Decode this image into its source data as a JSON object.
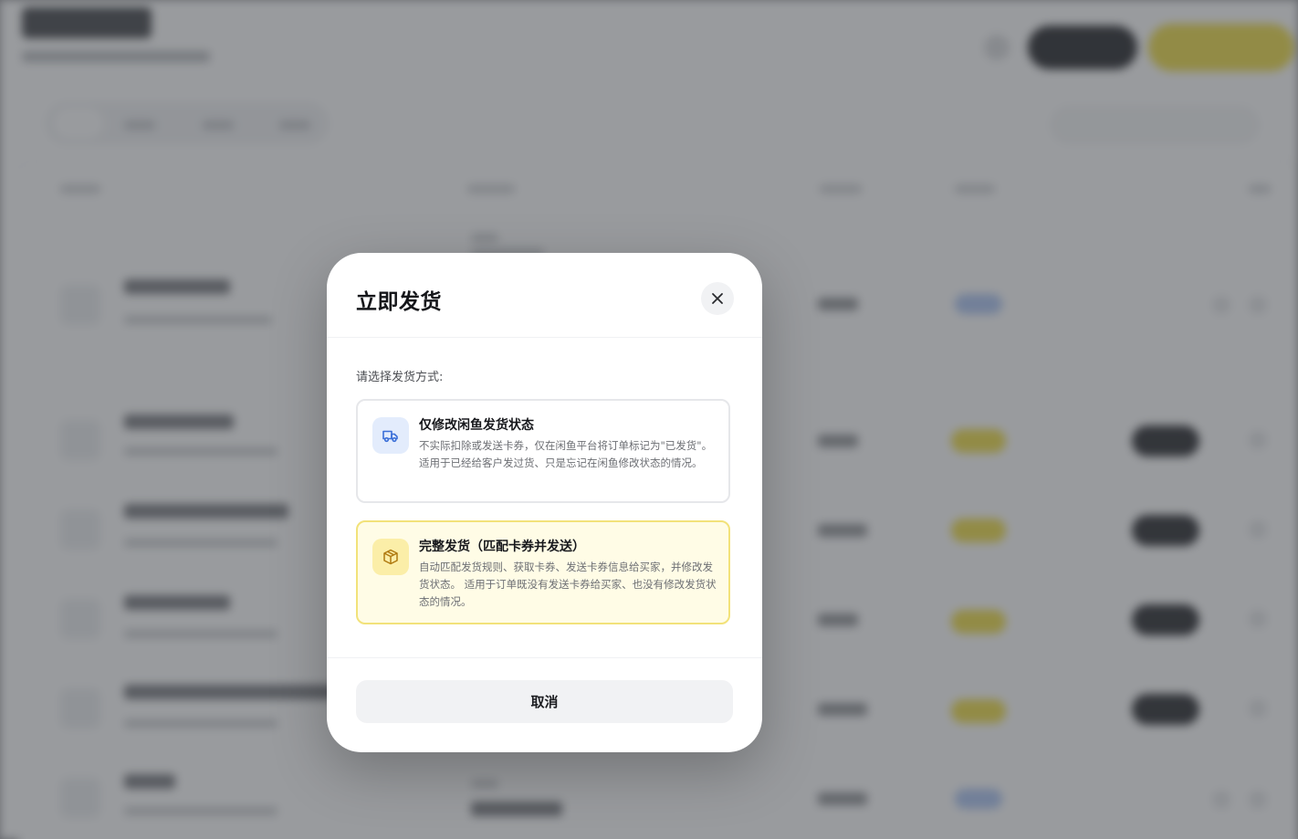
{
  "modal": {
    "title": "立即发货",
    "prompt": "请选择发货方式:",
    "options": [
      {
        "title": "仅修改闲鱼发货状态",
        "description": "不实际扣除或发送卡券，仅在闲鱼平台将订单标记为\"已发货\"。适用于已经给客户发过货、只是忘记在闲鱼修改状态的情况。",
        "icon": "truck-icon"
      },
      {
        "title": "完整发货（匹配卡券并发送）",
        "description": "自动匹配发货规则、获取卡券、发送卡券信息给买家，并修改发货状态。 适用于订单既没有发送卡券给买家、也没有修改发货状态的情况。",
        "icon": "package-icon"
      }
    ],
    "cancel_label": "取消"
  },
  "colors": {
    "accent_yellow": "#F0DC3C",
    "option_selected_border": "#F2E27A",
    "option_selected_bg": "#FFFCE6",
    "icon_blue_bg": "#E3ECFC",
    "icon_blue": "#3B6FD8",
    "icon_yellow": "#B07A10"
  }
}
